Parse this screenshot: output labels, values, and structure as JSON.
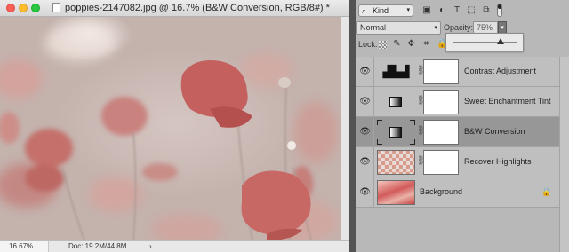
{
  "document": {
    "title": "poppies-2147082.jpg @ 16.7% (B&W Conversion, RGB/8#) *",
    "zoom": "16.67%",
    "doc_size": "Doc: 19.2M/44.8M",
    "status_arrow": "›"
  },
  "filter_bar": {
    "kind_label": "Kind",
    "search_glyph": "⌕",
    "dropdown_glyph": "▾",
    "icons": {
      "pixel": "▣",
      "adjustment": "◐",
      "type": "T",
      "shape": "⬚",
      "smart_object": "⧉"
    }
  },
  "options": {
    "blend_mode": "Normal",
    "opacity_label": "Opacity:",
    "opacity_value": "75%",
    "dropdown_glyph": "▾",
    "lock_label": "Lock:",
    "lock_icons": {
      "paint": "✎",
      "move": "✥",
      "artboard": "⌗",
      "all": "🔒"
    },
    "opacity_slider_fraction": 0.75
  },
  "layers": [
    {
      "name": "Contrast Adjustment",
      "selected": false,
      "thumb_type": "levels",
      "thumb_glyph": "▟▙▟",
      "eye": "👁",
      "chain": "⛓"
    },
    {
      "name": "Sweet Enchantment Tint",
      "selected": false,
      "thumb_type": "gradient",
      "eye": "👁",
      "chain": "⛓"
    },
    {
      "name": "B&W Conversion",
      "selected": true,
      "thumb_type": "gradient",
      "eye": "👁",
      "chain": "⛓"
    },
    {
      "name": "Recover Highlights",
      "selected": false,
      "thumb_type": "pixel",
      "eye": "👁",
      "chain": "⛓"
    },
    {
      "name": "Background",
      "selected": false,
      "thumb_type": "image",
      "eye": "👁",
      "lock_glyph": "🔒"
    }
  ],
  "colors": {
    "selected_row": "#979797",
    "panel_bg": "#b8b8b8",
    "poppy_red": "#c46a66"
  }
}
